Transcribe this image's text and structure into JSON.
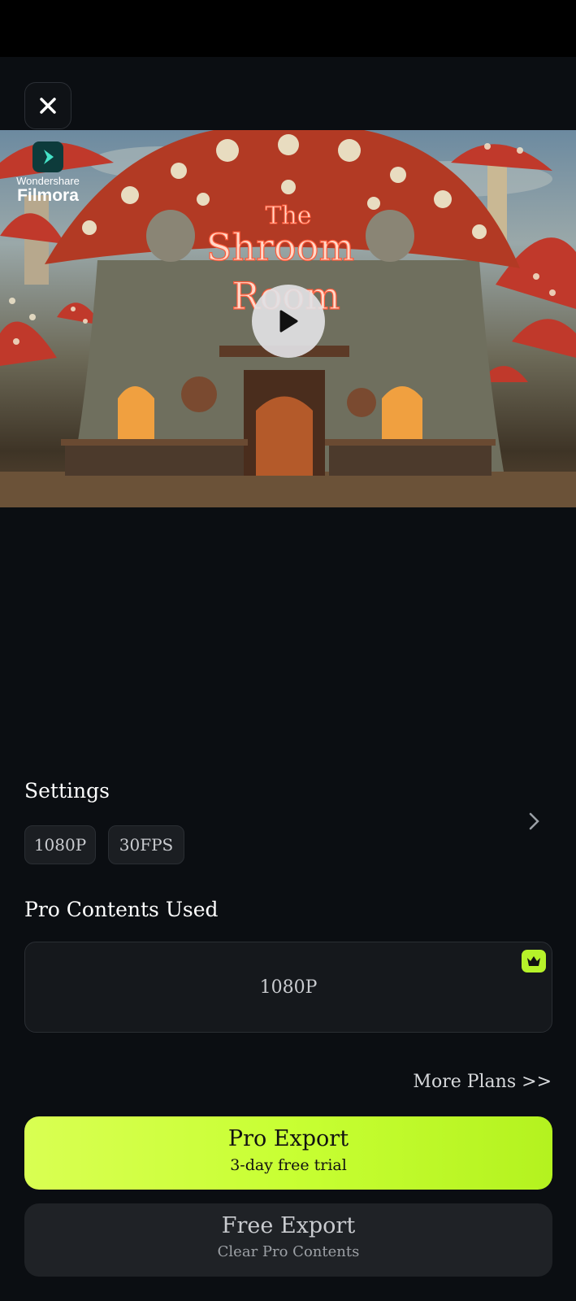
{
  "preview": {
    "watermark_brand_small": "Wondershare",
    "watermark_brand_big": "Filmora",
    "sign_line1": "The",
    "sign_line2": "Shroom",
    "sign_line3": "Room"
  },
  "settings": {
    "title": "Settings",
    "resolution": "1080P",
    "fps": "30FPS"
  },
  "pro_contents": {
    "title": "Pro Contents Used",
    "item": "1080P"
  },
  "more_plans": "More Plans >>",
  "pro_export": {
    "label": "Pro Export",
    "sublabel": "3-day free trial"
  },
  "free_export": {
    "label": "Free Export",
    "sublabel": "Clear Pro Contents"
  },
  "colors": {
    "background": "#0b0e12",
    "accent": "#c8ff33",
    "card": "#15181c"
  },
  "icons": [
    "close-icon",
    "play-icon",
    "chevron-right-icon",
    "crown-icon",
    "filmora-logo-icon"
  ]
}
